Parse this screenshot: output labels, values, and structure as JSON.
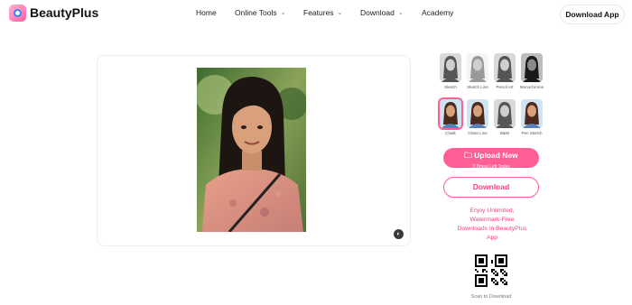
{
  "nav": {
    "logo_text": "BeautyPlus",
    "items": [
      {
        "label": "Home",
        "has_dropdown": false
      },
      {
        "label": "Online Tools",
        "has_dropdown": true
      },
      {
        "label": "Features",
        "has_dropdown": true
      },
      {
        "label": "Download",
        "has_dropdown": true
      },
      {
        "label": "Academy",
        "has_dropdown": false
      }
    ],
    "cta": "Download App"
  },
  "styles": [
    {
      "label": "Sketch",
      "tone": "gray",
      "selected": false
    },
    {
      "label": "Sketch Line",
      "tone": "line",
      "selected": false
    },
    {
      "label": "Pencil Art",
      "tone": "gray",
      "selected": false
    },
    {
      "label": "Monochrome",
      "tone": "dark",
      "selected": false
    },
    {
      "label": "Chalk",
      "tone": "color",
      "selected": true
    },
    {
      "label": "Clean Line",
      "tone": "color",
      "selected": false
    },
    {
      "label": "B&W",
      "tone": "gray",
      "selected": false
    },
    {
      "label": "Pen Sketch",
      "tone": "color",
      "selected": false
    }
  ],
  "actions": {
    "upload_label": "Upload New",
    "upload_sub": "3 Times Left Today",
    "download_label": "Download"
  },
  "promo": {
    "line1": "Enjoy Unlimited,",
    "line2": "Watermark-Free",
    "line3": "Downloads in  BeautyPlus",
    "line4": "App"
  },
  "scan_label": "Scan to Download",
  "colors": {
    "accent": "#ff5f93",
    "accent_text": "#ff3d7f"
  }
}
